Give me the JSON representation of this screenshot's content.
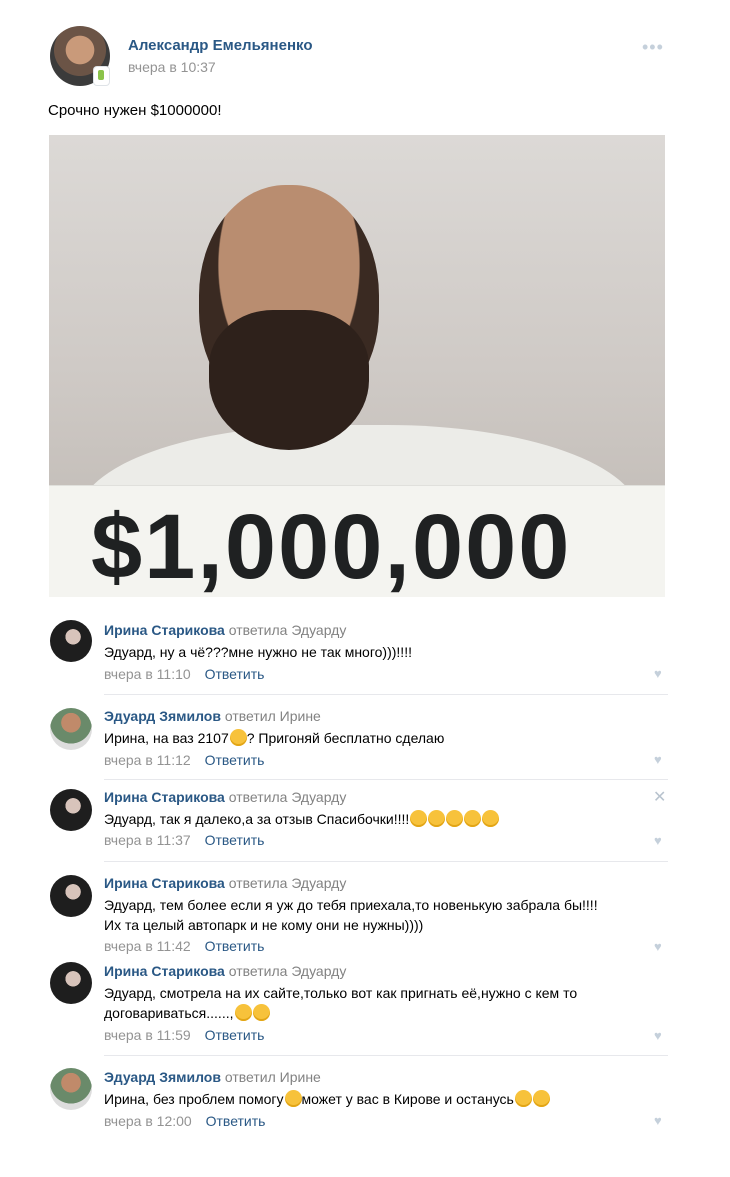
{
  "post": {
    "author": "Александр Емельяненко",
    "time": "вчера в 10:37",
    "text": "Срочно нужен $1000000!",
    "photo_sign_text": "$1,000,000"
  },
  "comments": [
    {
      "name": "Ирина Старикова",
      "reply": "ответила Эдуарду",
      "text": "Эдуард, ну а чё???мне нужно не так много)))!!!!",
      "time": "вчера в 11:10",
      "answer": "Ответить"
    },
    {
      "name": "Эдуард Зямилов",
      "reply": "ответил Ирине",
      "text_a": "Ирина, на ваз 2107",
      "text_b": "? Пригоняй бесплатно сделаю",
      "time": "вчера в 11:12",
      "answer": "Ответить"
    },
    {
      "name": "Ирина Старикова",
      "reply": "ответила Эдуарду",
      "text": "Эдуард, так я далеко,а за отзыв Спасибочки!!!!",
      "time": "вчера в 11:37",
      "answer": "Ответить"
    },
    {
      "name": "Ирина Старикова",
      "reply": "ответила Эдуарду",
      "text_line1": "Эдуард, тем более если я уж до тебя приехала,то новенькую забрала бы!!!!",
      "text_line2": "Их та целый автопарк и не кому они не нужны))))",
      "time": "вчера в 11:42",
      "answer": "Ответить"
    },
    {
      "name": "Ирина Старикова",
      "reply": "ответила Эдуарду",
      "text_line1": "Эдуард, смотрела на их сайте,только вот как пригнать её,нужно с кем то",
      "text_line2": "договариваться......,",
      "time": "вчера в 11:59",
      "answer": "Ответить"
    },
    {
      "name": "Эдуард Зямилов",
      "reply": "ответил Ирине",
      "text_a": "Ирина, без проблем помогу",
      "text_b": "может у вас в Кирове и останусь",
      "time": "вчера в 12:00",
      "answer": "Ответить"
    }
  ],
  "icons": {
    "more": "more-dots-icon",
    "like": "heart-icon",
    "close": "close-icon"
  }
}
